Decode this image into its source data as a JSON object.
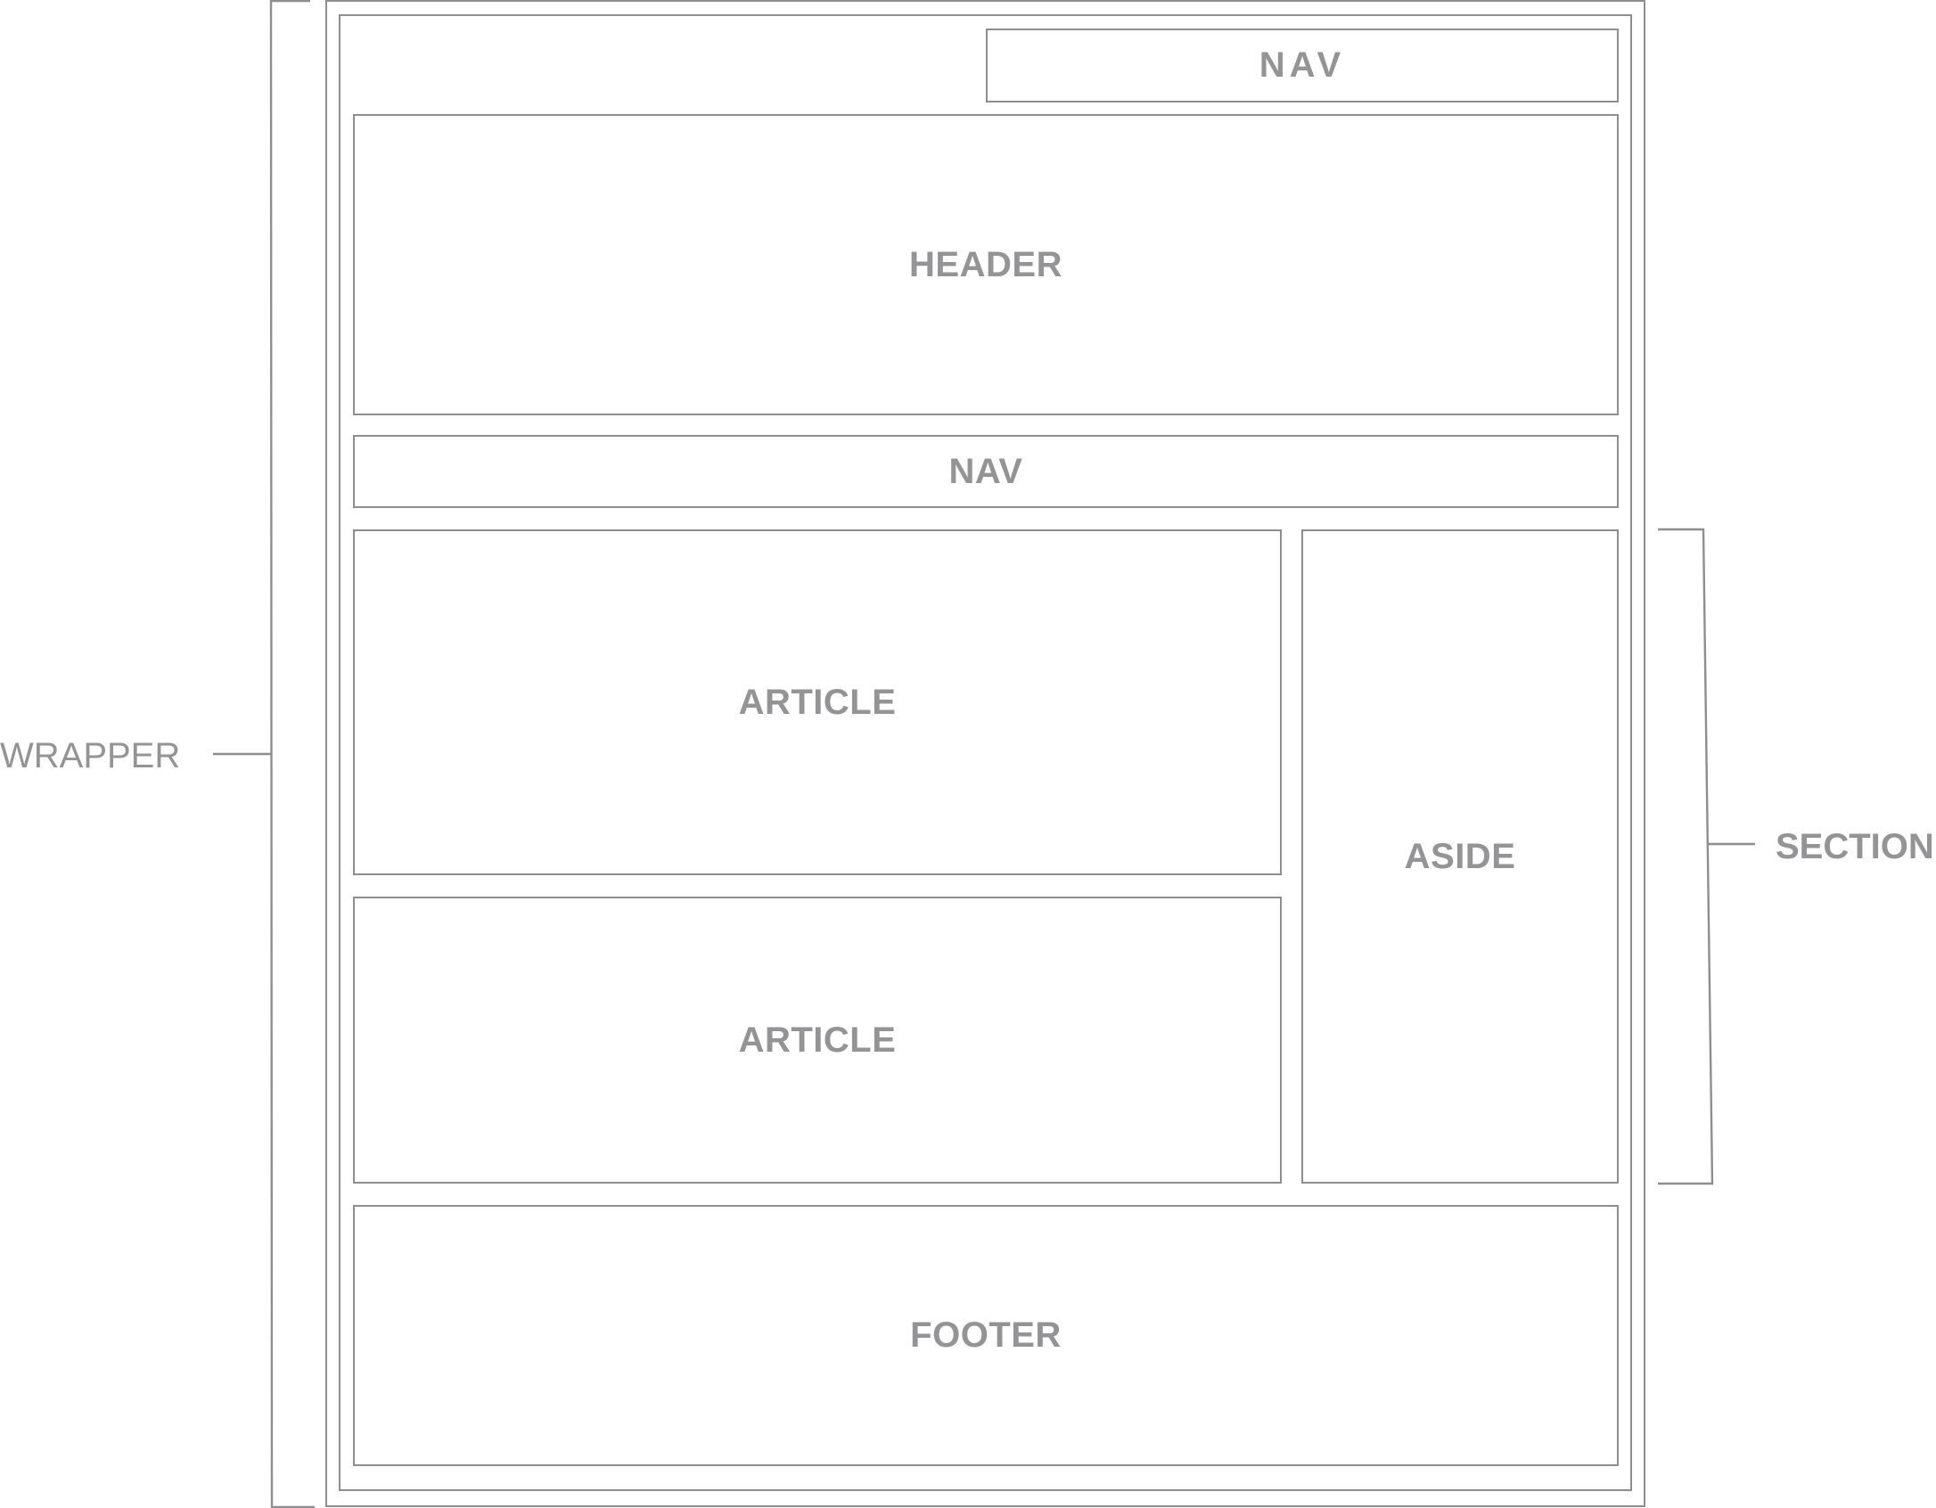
{
  "diagram": {
    "blocks": {
      "nav_top": "NAV",
      "header": "HEADER",
      "nav_main": "NAV",
      "article_1": "ARTICLE",
      "article_2": "ARTICLE",
      "aside": "ASIDE",
      "footer": "FOOTER"
    },
    "annotations": {
      "wrapper": "WRAPPER",
      "section": "SECTION"
    },
    "colors": {
      "line": "#8e8e90",
      "text": "#949496",
      "background": "#ffffff"
    }
  }
}
